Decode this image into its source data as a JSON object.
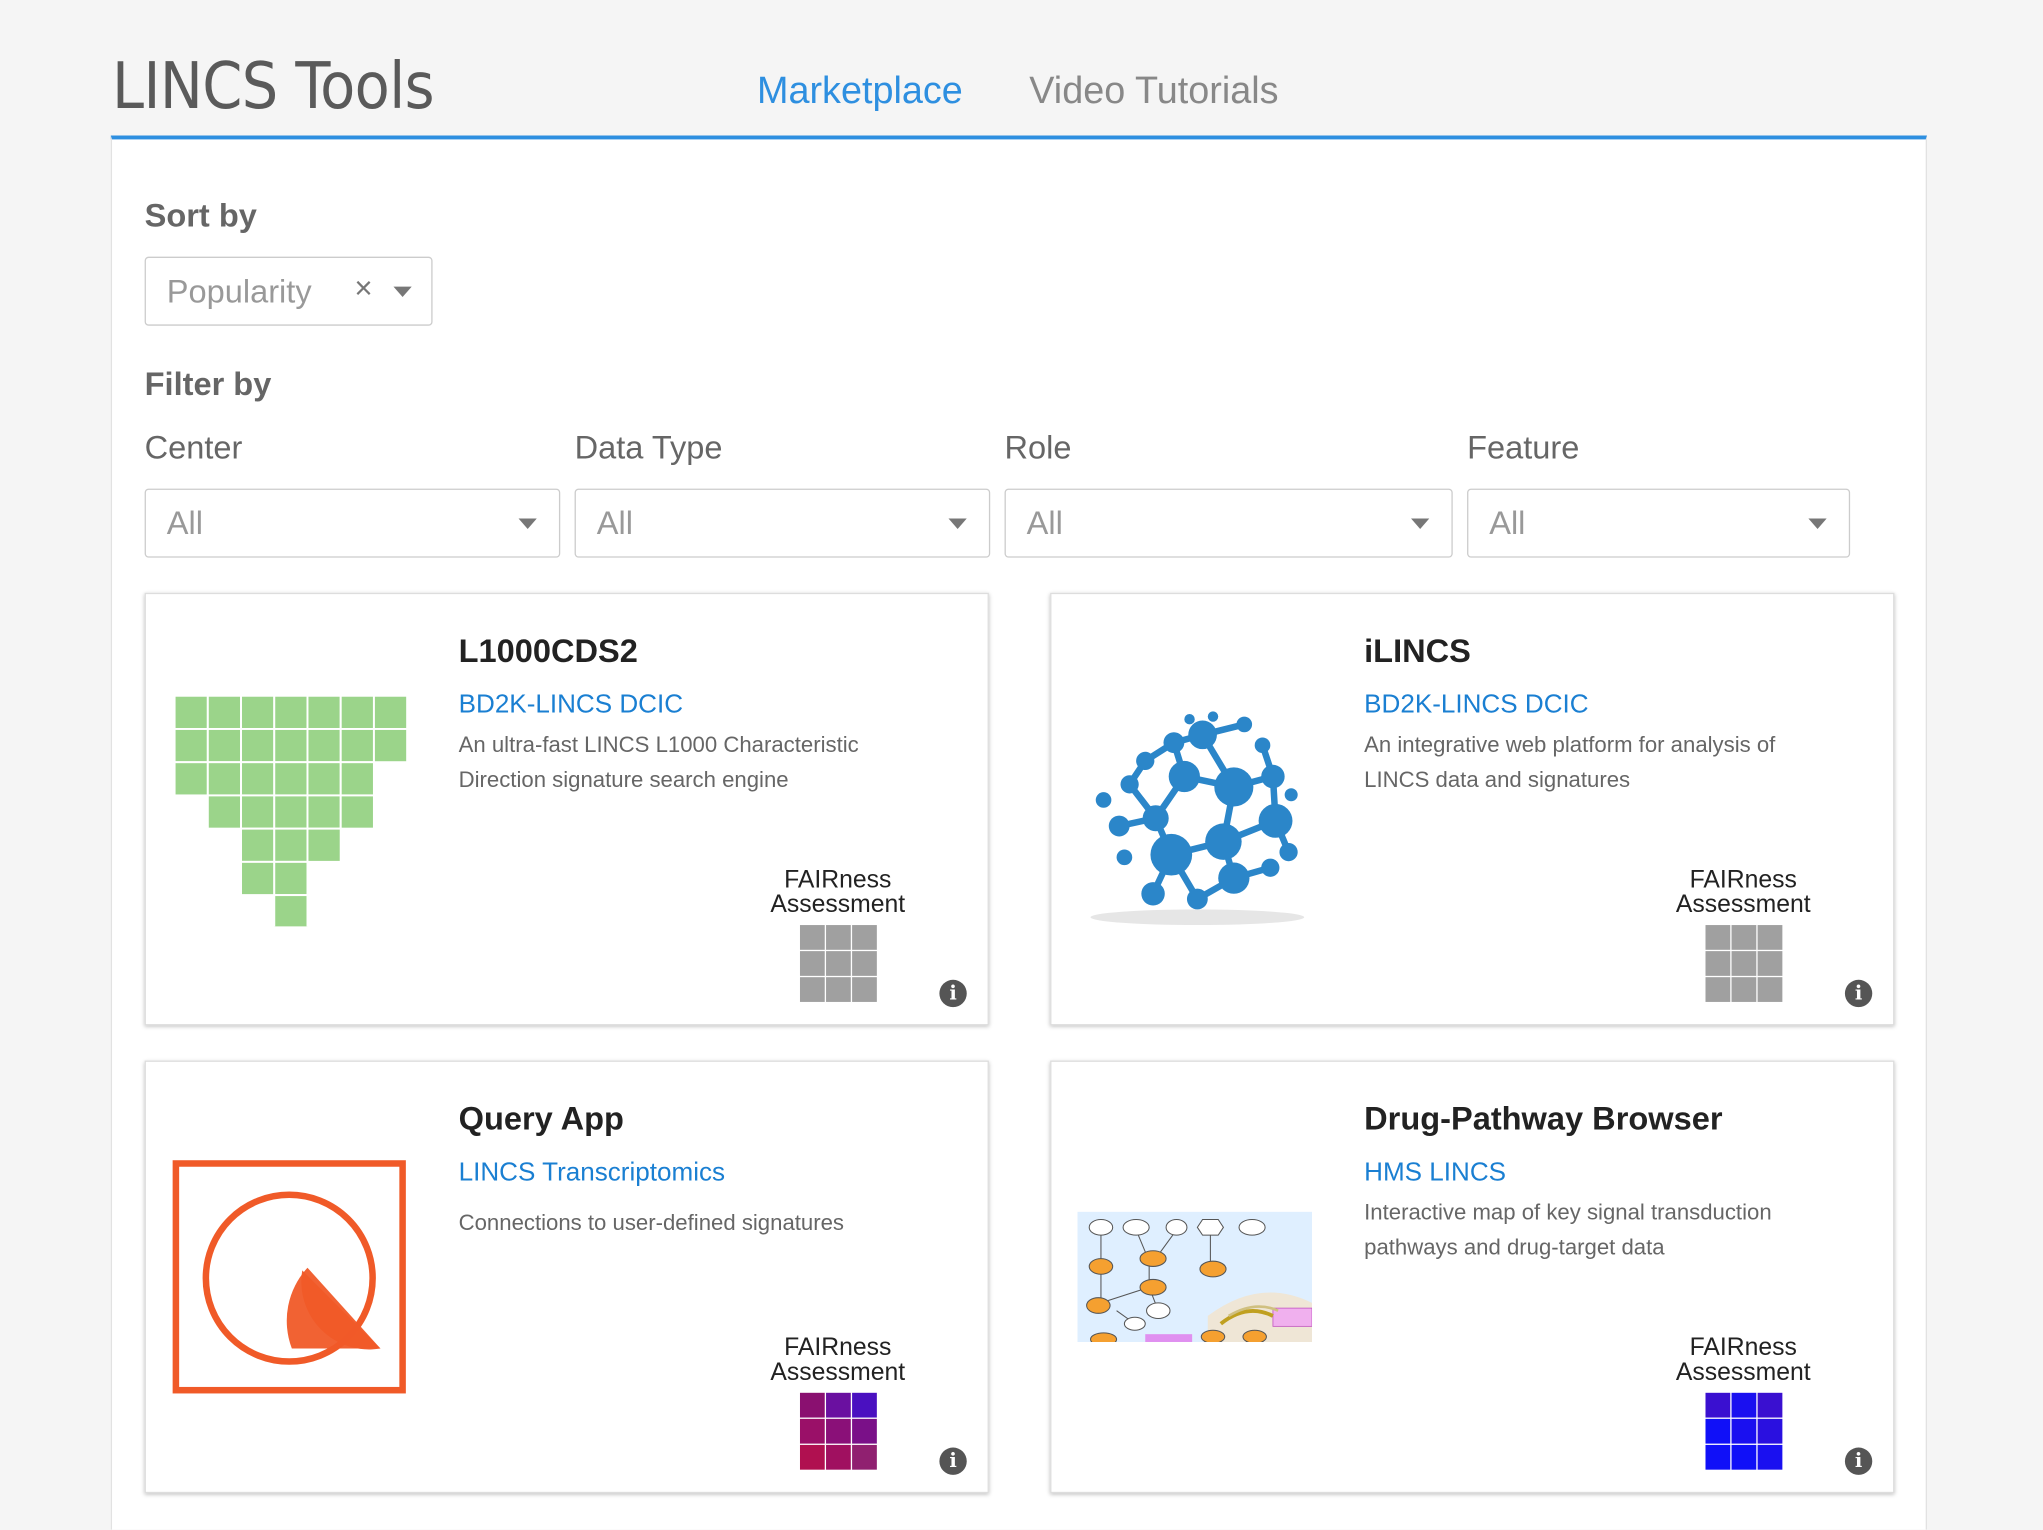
{
  "header": {
    "title": "LINCS Tools",
    "tabs": [
      {
        "label": "Marketplace",
        "active": true
      },
      {
        "label": "Video Tutorials",
        "active": false
      }
    ],
    "accent_color": "#2e8fe0"
  },
  "sort": {
    "label": "Sort by",
    "value": "Popularity",
    "clear_symbol": "×"
  },
  "filter": {
    "label": "Filter by",
    "fields": [
      {
        "label": "Center",
        "value": "All"
      },
      {
        "label": "Data Type",
        "value": "All"
      },
      {
        "label": "Role",
        "value": "All"
      },
      {
        "label": "Feature",
        "value": "All"
      }
    ]
  },
  "cards": [
    {
      "title": "L1000CDS2",
      "center": "BD2K-LINCS DCIC",
      "description": "An ultra-fast LINCS L1000 Characteristic Direction signature search engine",
      "logo": "l1000cds2-logo",
      "fair_label": "FAIRness\nAssessment",
      "fair_colors": [
        "#a0a0a0",
        "#a0a0a0",
        "#a0a0a0",
        "#a0a0a0",
        "#a0a0a0",
        "#a0a0a0",
        "#a0a0a0",
        "#a0a0a0",
        "#a0a0a0"
      ],
      "info_symbol": "i"
    },
    {
      "title": "iLINCS",
      "center": "BD2K-LINCS DCIC",
      "description": "An integrative web platform for analysis of LINCS data and signatures",
      "logo": "ilincs-network-logo",
      "fair_label": "FAIRness\nAssessment",
      "fair_colors": [
        "#a0a0a0",
        "#a0a0a0",
        "#a0a0a0",
        "#a0a0a0",
        "#a0a0a0",
        "#a0a0a0",
        "#a0a0a0",
        "#a0a0a0",
        "#a0a0a0"
      ],
      "info_symbol": "i"
    },
    {
      "title": "Query App",
      "center": "LINCS Transcriptomics",
      "description": "Connections to user-defined signatures",
      "logo": "query-app-logo",
      "fair_label": "FAIRness\nAssessment",
      "fair_colors": [
        "#8a1070",
        "#6a10a0",
        "#4a10c0",
        "#9a1068",
        "#8a1078",
        "#7a1088",
        "#b01050",
        "#a01060",
        "#902070"
      ],
      "info_symbol": "i"
    },
    {
      "title": "Drug-Pathway Browser",
      "center": "HMS LINCS",
      "description": "Interactive map of key signal transduction pathways and drug-target data",
      "logo": "pathway-diagram-thumbnail",
      "fair_label": "FAIRness\nAssessment",
      "fair_colors": [
        "#3a10d0",
        "#1a10f0",
        "#3a10d0",
        "#1010f8",
        "#1a10f0",
        "#2a10e0",
        "#1010f8",
        "#1010f8",
        "#1a10f0"
      ],
      "info_symbol": "i"
    }
  ]
}
